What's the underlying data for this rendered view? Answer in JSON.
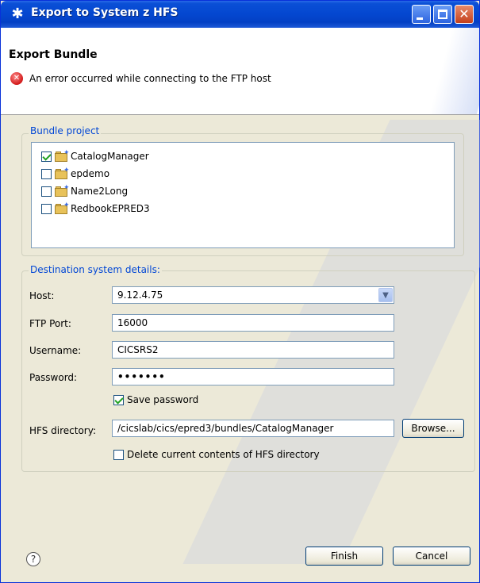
{
  "window": {
    "title": "Export to System z HFS",
    "icon": "eclipse-star-icon"
  },
  "header": {
    "title": "Export Bundle",
    "error_message": "An error occurred while connecting to the FTP host"
  },
  "bundle_project": {
    "label": "Bundle project",
    "items": [
      {
        "label": "CatalogManager",
        "checked": true
      },
      {
        "label": "epdemo",
        "checked": false
      },
      {
        "label": "Name2Long",
        "checked": false
      },
      {
        "label": "RedbookEPRED3",
        "checked": false
      }
    ]
  },
  "destination": {
    "label": "Destination system details:",
    "host_label": "Host:",
    "host_value": "9.12.4.75",
    "ftp_port_label": "FTP Port:",
    "ftp_port_value": "16000",
    "username_label": "Username:",
    "username_value": "CICSRS2",
    "password_label": "Password:",
    "password_value": "•••••••",
    "save_password_label": "Save password",
    "save_password_checked": true,
    "hfs_dir_label": "HFS directory:",
    "hfs_dir_value": "/cicslab/cics/epred3/bundles/CatalogManager",
    "browse_label": "Browse...",
    "delete_contents_label": "Delete current contents of HFS directory",
    "delete_contents_checked": false
  },
  "footer": {
    "help_glyph": "?",
    "finish_label": "Finish",
    "cancel_label": "Cancel"
  }
}
